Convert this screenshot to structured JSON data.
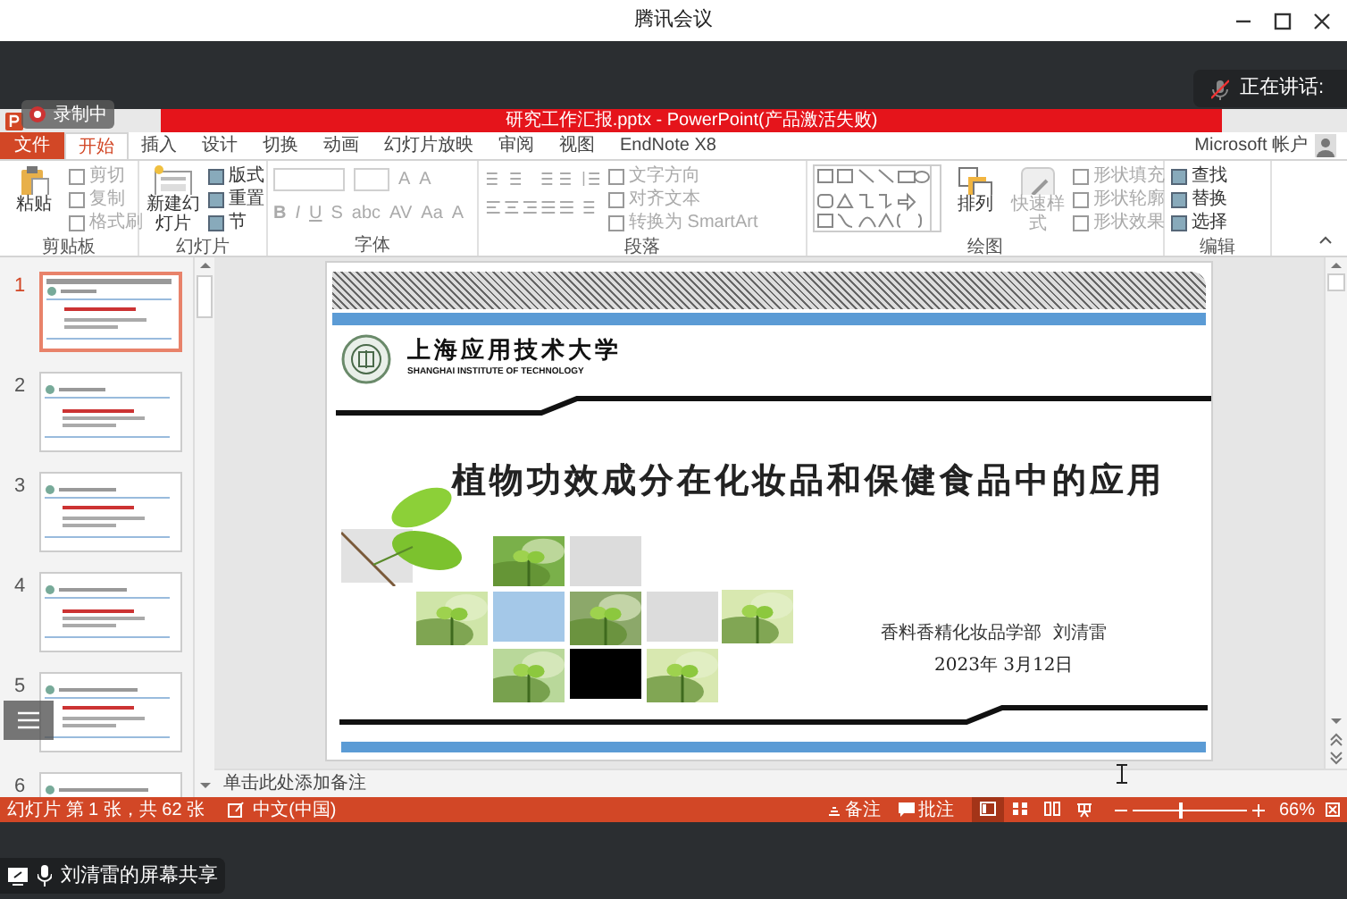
{
  "window": {
    "title": "腾讯会议"
  },
  "meeting": {
    "recording_label": "录制中",
    "speaking_label": "正在讲话:",
    "share_label": "刘清雷的屏幕共享"
  },
  "app": {
    "title": "研究工作汇报.pptx - PowerPoint(产品激活失败)",
    "account": "Microsoft 帐户"
  },
  "tabs": [
    {
      "label": "文件",
      "kind": "file",
      "selected": false
    },
    {
      "label": "开始",
      "kind": "tab",
      "selected": true
    },
    {
      "label": "插入",
      "kind": "tab",
      "selected": false
    },
    {
      "label": "设计",
      "kind": "tab",
      "selected": false
    },
    {
      "label": "切换",
      "kind": "tab",
      "selected": false
    },
    {
      "label": "动画",
      "kind": "tab",
      "selected": false
    },
    {
      "label": "幻灯片放映",
      "kind": "tab",
      "selected": false
    },
    {
      "label": "审阅",
      "kind": "tab",
      "selected": false
    },
    {
      "label": "视图",
      "kind": "tab",
      "selected": false
    },
    {
      "label": "EndNote X8",
      "kind": "tab",
      "selected": false
    }
  ],
  "ribbon_groups": [
    {
      "label": "剪贴板",
      "kind": "clipboard",
      "columns": [
        [
          {
            "label": "粘贴",
            "kind": "large",
            "disabled": false
          }
        ],
        [
          {
            "label": "剪切",
            "kind": "small",
            "disabled": true
          },
          {
            "label": "复制",
            "kind": "small",
            "disabled": true
          },
          {
            "label": "格式刷",
            "kind": "small",
            "disabled": true
          }
        ]
      ]
    },
    {
      "label": "幻灯片",
      "kind": "slides",
      "columns": [
        [
          {
            "label": "新建幻灯片",
            "kind": "large",
            "disabled": false
          }
        ],
        [
          {
            "label": "版式",
            "kind": "small",
            "disabled": false
          },
          {
            "label": "重置",
            "kind": "small",
            "disabled": false
          },
          {
            "label": "节",
            "kind": "small",
            "disabled": false
          }
        ]
      ]
    },
    {
      "label": "字体",
      "kind": "font",
      "lines": [
        [
          {
            "kind": "field"
          },
          {
            "kind": "field"
          },
          {
            "label": "A",
            "kind": "small",
            "disabled": true
          },
          {
            "label": "A",
            "kind": "small",
            "disabled": true
          }
        ],
        [
          {
            "label": "B",
            "kind": "small",
            "disabled": true
          },
          {
            "label": "I",
            "kind": "small",
            "disabled": true
          },
          {
            "label": "U",
            "kind": "small",
            "disabled": true
          },
          {
            "label": "S",
            "kind": "small",
            "disabled": true
          },
          {
            "label": "abc",
            "kind": "small",
            "disabled": true
          },
          {
            "label": "AV",
            "kind": "small",
            "disabled": true
          },
          {
            "label": "Aa",
            "kind": "small",
            "disabled": true
          },
          {
            "label": "A",
            "kind": "small",
            "disabled": true
          }
        ]
      ]
    },
    {
      "label": "段落",
      "kind": "paragraph",
      "columns": [
        [
          {
            "label": "文字方向",
            "kind": "small",
            "disabled": true
          },
          {
            "label": "对齐文本",
            "kind": "small",
            "disabled": true
          },
          {
            "label": "转换为 SmartArt",
            "kind": "small",
            "disabled": true
          }
        ]
      ]
    },
    {
      "label": "绘图",
      "kind": "drawing",
      "columns": [
        [
          {
            "label": "排列",
            "kind": "large",
            "disabled": false
          }
        ],
        [
          {
            "label": "快速样式",
            "kind": "large",
            "disabled": true
          }
        ],
        [
          {
            "label": "形状填充",
            "kind": "small",
            "disabled": true
          },
          {
            "label": "形状轮廓",
            "kind": "small",
            "disabled": true
          },
          {
            "label": "形状效果",
            "kind": "small",
            "disabled": true
          }
        ]
      ]
    },
    {
      "label": "编辑",
      "kind": "editing",
      "columns": [
        [
          {
            "label": "查找",
            "kind": "small",
            "disabled": false
          },
          {
            "label": "替换",
            "kind": "small",
            "disabled": false
          },
          {
            "label": "选择",
            "kind": "small",
            "disabled": false
          }
        ]
      ]
    }
  ],
  "thumbnails": [
    {
      "number": "1",
      "selected": true
    },
    {
      "number": "2",
      "selected": false
    },
    {
      "number": "3",
      "selected": false
    },
    {
      "number": "4",
      "selected": false
    },
    {
      "number": "5",
      "selected": false
    },
    {
      "number": "6",
      "selected": false
    }
  ],
  "slide": {
    "school_name": "上海应用技术大学",
    "school_name_en": "SHANGHAI INSTITUTE OF TECHNOLOGY",
    "title": "植物功效成分在化妆品和保健食品中的应用",
    "author": "香料香精化妆品学部  刘清雷",
    "date": "2023年 3月12日"
  },
  "notes": {
    "placeholder": "单击此处添加备注"
  },
  "status_bar": {
    "slide_info": "幻灯片 第 1 张，共 62 张",
    "language": "中文(中国)",
    "notes_button": "备注",
    "comments_button": "批注",
    "views": [
      {
        "kind": "normal",
        "selected": true
      },
      {
        "kind": "sorter",
        "selected": false
      },
      {
        "kind": "reading",
        "selected": false
      },
      {
        "kind": "show",
        "selected": false
      }
    ],
    "zoom_slider": {
      "level": 0.4
    },
    "zoom": "66%"
  }
}
